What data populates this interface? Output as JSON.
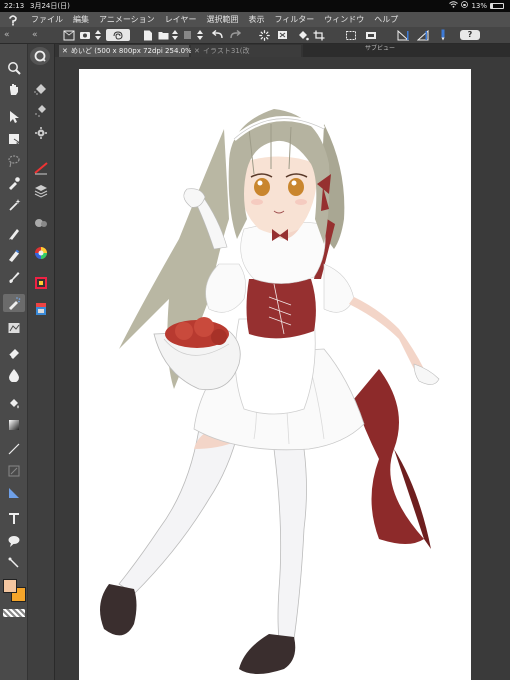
{
  "statusbar": {
    "time": "22:13",
    "date": "3月24日(日)",
    "battery": "13%"
  },
  "menubar": {
    "items": [
      "ファイル",
      "編集",
      "アニメーション",
      "レイヤー",
      "選択範囲",
      "表示",
      "フィルター",
      "ウィンドウ",
      "ヘルプ"
    ]
  },
  "toolbar": {
    "help_label": "?"
  },
  "tabs": [
    {
      "label": "めいど (500 x 800px 72dpi 254.0%)"
    },
    {
      "label": "イラスト31(改"
    }
  ],
  "subview": {
    "label": "サブビュー"
  },
  "colors": {
    "main": "#f4c6a0",
    "sub": "#f5a52a"
  },
  "canvas": {
    "background": "#ffffff",
    "subject": "maid-girl-illustration"
  }
}
